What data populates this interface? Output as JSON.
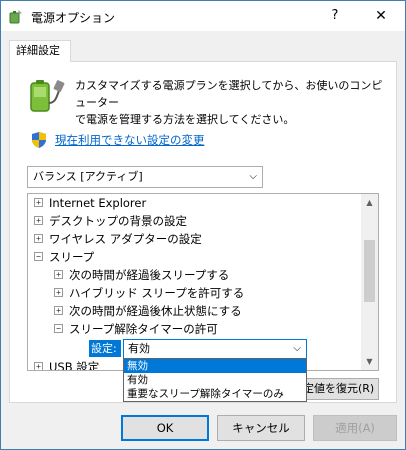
{
  "window": {
    "title": "電源オプション",
    "help": "?",
    "close": "✕"
  },
  "tab": {
    "label": "詳細設定"
  },
  "description": {
    "line1": "カスタマイズする電源プランを選択してから、お使いのコンピューター",
    "line2": "で電源を管理する方法を選択してください。"
  },
  "change_link": "現在利用できない設定の変更",
  "plan_select": {
    "value": "バランス [アクティブ]",
    "arrow": "⌵"
  },
  "tree": {
    "items": [
      {
        "label": "Internet Explorer",
        "expander": "+"
      },
      {
        "label": "デスクトップの背景の設定",
        "expander": "+"
      },
      {
        "label": "ワイヤレス アダプターの設定",
        "expander": "+"
      },
      {
        "label": "スリープ",
        "expander": "−"
      },
      {
        "label": "次の時間が経過後スリープする",
        "expander": "+"
      },
      {
        "label": "ハイブリッド スリープを許可する",
        "expander": "+"
      },
      {
        "label": "次の時間が経過後休止状態にする",
        "expander": "+"
      },
      {
        "label": "スリープ解除タイマーの許可",
        "expander": "−"
      },
      {
        "label": "USB 設定",
        "expander": "+"
      }
    ],
    "scroll_up": "▲",
    "scroll_down": "▼"
  },
  "setting": {
    "label": "設定:",
    "value": "有効",
    "arrow": "⌵",
    "options": [
      "無効",
      "有効",
      "重要なスリープ解除タイマーのみ"
    ]
  },
  "restore_button": "プランの既定値を復元(R)",
  "buttons": {
    "ok": "OK",
    "cancel": "キャンセル",
    "apply": "適用(A)"
  },
  "colors": {
    "accent": "#0078d7",
    "link": "#0066cc"
  }
}
